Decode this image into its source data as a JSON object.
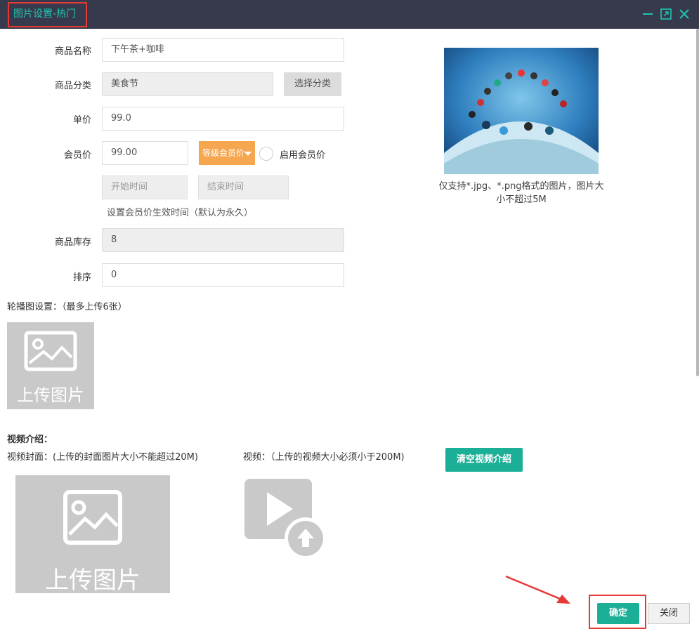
{
  "window": {
    "title": "图片设置-热门"
  },
  "form": {
    "name_label": "商品名称",
    "name_value": "下午茶+咖啡",
    "category_label": "商品分类",
    "category_value": "美食节",
    "category_button": "选择分类",
    "price_label": "单价",
    "price_value": "99.0",
    "member_price_label": "会员价",
    "member_price_value": "99.00",
    "member_level_button": "等级会员价",
    "enable_member_price_label": "启用会员价",
    "start_time_placeholder": "开始时间",
    "end_time_placeholder": "结束时间",
    "time_hint": "设置会员价生效时间（默认为永久）",
    "stock_label": "商品库存",
    "stock_value": "8",
    "sort_label": "排序",
    "sort_value": "0"
  },
  "image_note": "仅支持*.jpg、*.png格式的图片，图片大小不超过5M",
  "carousel": {
    "title": "轮播图设置：（最多上传6张）",
    "upload_label": "上传图片"
  },
  "video": {
    "section_title": "视频介绍：",
    "cover_label": "视频封面：(上传的封面图片大小不能超过20M)",
    "video_label": "视频：（上传的视频大小必须小于200M)",
    "clear_button": "清空视频介绍",
    "cover_upload_label": "上传图片"
  },
  "footer": {
    "ok_button": "确定",
    "close_button": "关闭"
  },
  "colors": {
    "titlebar": "#373a4d",
    "accent": "#1fc6b4",
    "teal_button": "#1aaf96",
    "orange_button": "#f5a64f",
    "highlight": "#e53935"
  },
  "icons": [
    "minimize-icon",
    "maximize-icon",
    "close-icon",
    "image-placeholder-icon",
    "video-play-icon",
    "upload-arrow-icon",
    "dropdown-arrow-icon",
    "annotation-arrow"
  ]
}
